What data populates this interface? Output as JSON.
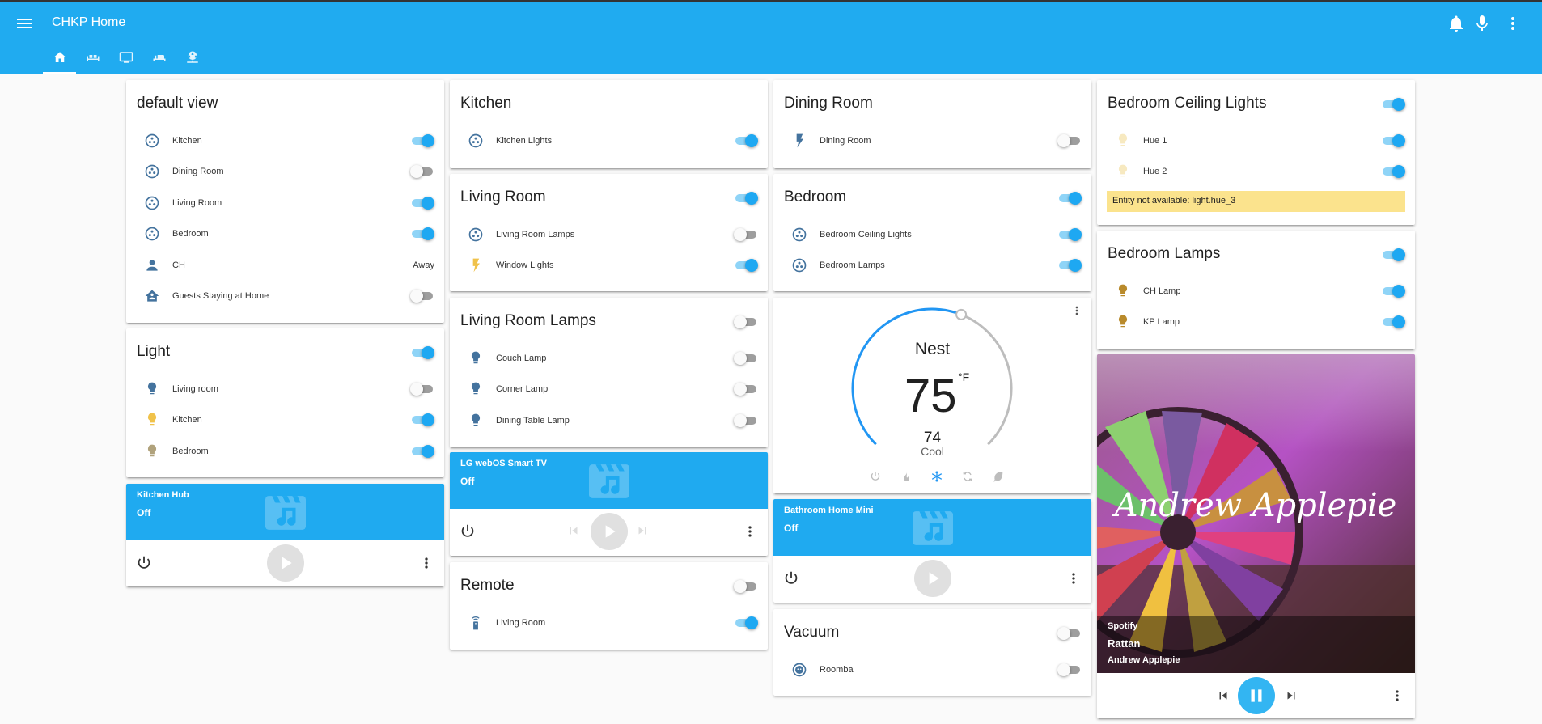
{
  "header": {
    "title": "CHKP Home",
    "menu_icon": "hamburger-menu-icon",
    "actions": [
      "notifications-bell-icon",
      "microphone-icon",
      "more-vert-icon"
    ],
    "bg_color": "#20abf0"
  },
  "tabs": [
    {
      "icon": "home-icon",
      "active": true
    },
    {
      "icon": "sofa-icon",
      "active": false
    },
    {
      "icon": "television-icon",
      "active": false
    },
    {
      "icon": "bed-icon",
      "active": false
    },
    {
      "icon": "network-globe-icon",
      "active": false
    }
  ],
  "cards": {
    "default_view": {
      "title": "default view",
      "rows": [
        {
          "icon": "group-icon",
          "label": "Kitchen",
          "on": true
        },
        {
          "icon": "group-icon",
          "label": "Dining Room",
          "on": false
        },
        {
          "icon": "group-icon",
          "label": "Living Room",
          "on": true
        },
        {
          "icon": "group-icon",
          "label": "Bedroom",
          "on": true
        },
        {
          "icon": "person-icon",
          "label": "CH",
          "state": "Away"
        },
        {
          "icon": "home-account-icon",
          "label": "Guests Staying at Home",
          "on": false
        }
      ]
    },
    "light": {
      "title": "Light",
      "on": true,
      "rows": [
        {
          "icon": "bulb-icon",
          "label": "Living room",
          "on": false,
          "color": "#44739e"
        },
        {
          "icon": "bulb-icon",
          "label": "Kitchen",
          "on": true,
          "color": "#f0c24a"
        },
        {
          "icon": "bulb-icon",
          "label": "Bedroom",
          "on": true,
          "color": "#b0a27c"
        }
      ]
    },
    "kitchen_hub": {
      "name": "Kitchen Hub",
      "state": "Off"
    },
    "kitchen": {
      "title": "Kitchen",
      "rows": [
        {
          "icon": "group-icon",
          "label": "Kitchen Lights",
          "on": true
        }
      ]
    },
    "living_room": {
      "title": "Living Room",
      "on": true,
      "rows": [
        {
          "icon": "group-icon",
          "label": "Living Room Lamps",
          "on": false
        },
        {
          "icon": "flash-icon",
          "label": "Window Lights",
          "on": true,
          "color": "#f0c24a"
        }
      ]
    },
    "living_room_lamps": {
      "title": "Living Room Lamps",
      "on": false,
      "rows": [
        {
          "icon": "bulb-icon",
          "label": "Couch Lamp",
          "on": false
        },
        {
          "icon": "bulb-icon",
          "label": "Corner Lamp",
          "on": false
        },
        {
          "icon": "bulb-icon",
          "label": "Dining Table Lamp",
          "on": false
        }
      ]
    },
    "lg_tv": {
      "name": "LG webOS Smart TV",
      "state": "Off"
    },
    "remote": {
      "title": "Remote",
      "on": false,
      "rows": [
        {
          "icon": "remote-icon",
          "label": "Living Room",
          "on": true
        }
      ]
    },
    "dining_room": {
      "title": "Dining Room",
      "rows": [
        {
          "icon": "flash-icon",
          "label": "Dining Room",
          "on": false
        }
      ]
    },
    "bedroom": {
      "title": "Bedroom",
      "on": true,
      "rows": [
        {
          "icon": "group-icon",
          "label": "Bedroom Ceiling Lights",
          "on": true
        },
        {
          "icon": "group-icon",
          "label": "Bedroom Lamps",
          "on": true
        }
      ]
    },
    "thermostat": {
      "name": "Nest",
      "target": "75",
      "unit": "°F",
      "current": "74",
      "mode": "Cool",
      "target_fraction": 0.58,
      "modes": [
        "power-icon",
        "flame-icon",
        "snowflake-icon",
        "auto-cycle-icon",
        "eco-leaf-icon"
      ],
      "active_mode": "snowflake-icon"
    },
    "bathroom": {
      "name": "Bathroom Home Mini",
      "state": "Off"
    },
    "vacuum": {
      "title": "Vacuum",
      "on": false,
      "rows": [
        {
          "icon": "robot-vacuum-icon",
          "label": "Roomba",
          "on": false
        }
      ]
    },
    "bedroom_ceiling": {
      "title": "Bedroom Ceiling Lights",
      "on": true,
      "rows": [
        {
          "icon": "bulb-icon",
          "label": "Hue 1",
          "on": true,
          "color": "#f7e9c0"
        },
        {
          "icon": "bulb-icon",
          "label": "Hue 2",
          "on": true,
          "color": "#f7e9c0"
        }
      ],
      "warning": "Entity not available: light.hue_3"
    },
    "bedroom_lamps": {
      "title": "Bedroom Lamps",
      "on": true,
      "rows": [
        {
          "icon": "bulb-icon",
          "label": "CH Lamp",
          "on": true,
          "color": "#b98a2b"
        },
        {
          "icon": "bulb-icon",
          "label": "KP Lamp",
          "on": true,
          "color": "#b98a2b"
        }
      ]
    },
    "spotify": {
      "app": "Spotify",
      "track": "Rattan",
      "artist": "Andrew Applepie",
      "art_text": "Andrew Applepie",
      "playing": true
    }
  },
  "colors": {
    "accent": "#1ea8f2",
    "icon": "#44739e",
    "media_bg": "#1faaf0",
    "warning_bg": "#fbe38d"
  }
}
